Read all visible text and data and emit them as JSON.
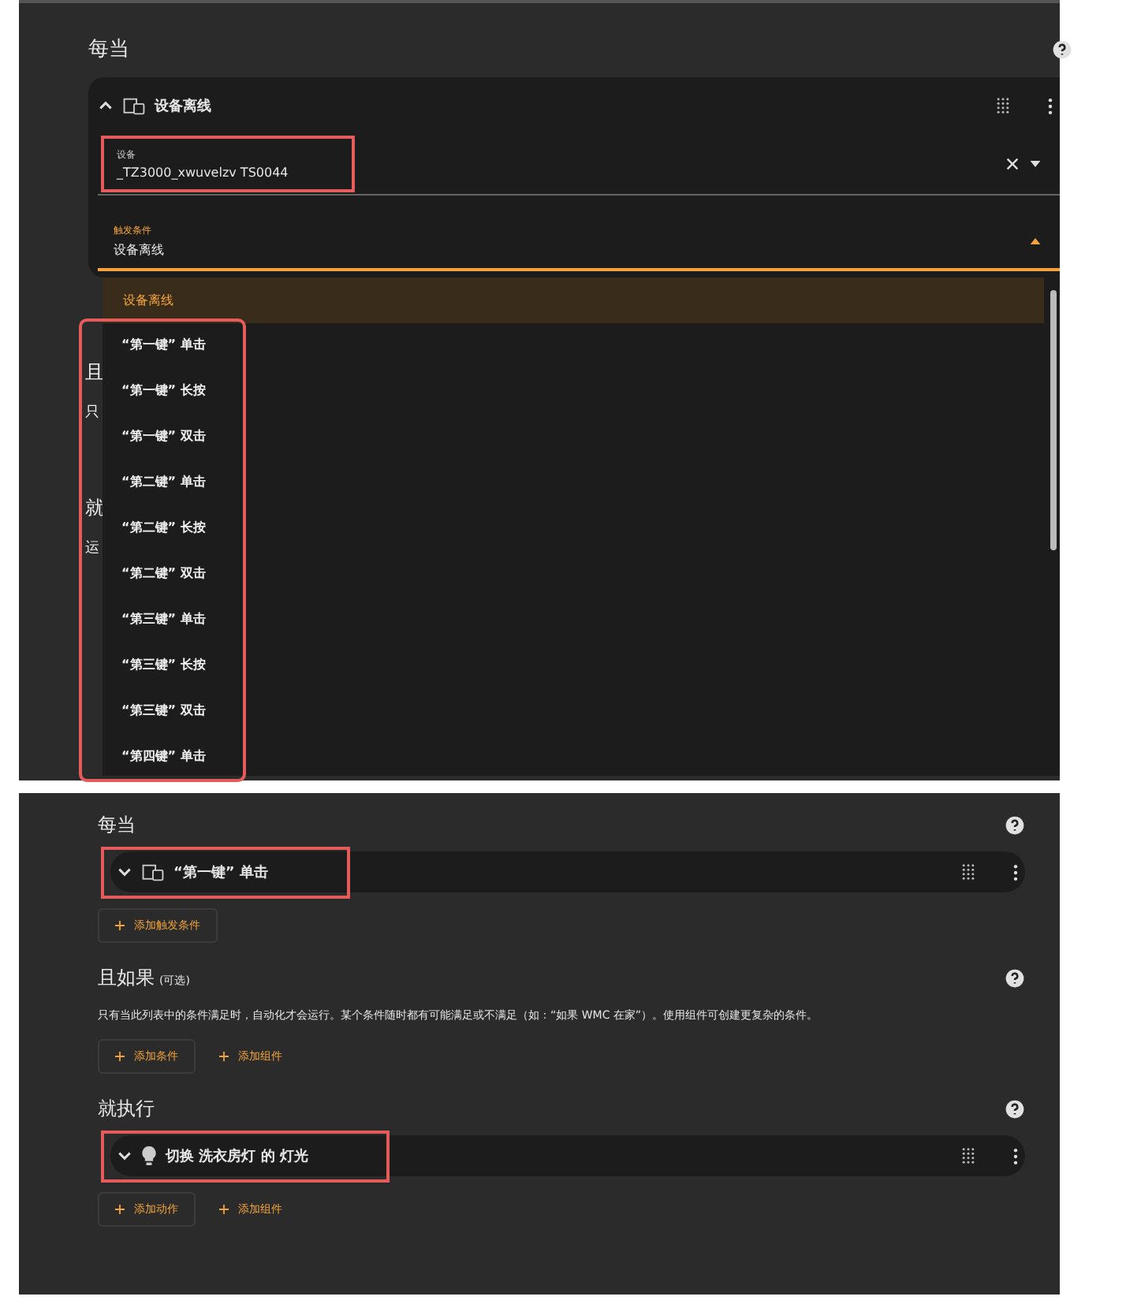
{
  "top_screenshot": {
    "section_title": "每当",
    "trigger_card": {
      "title": "设备离线",
      "expanded": true
    },
    "device_field": {
      "label": "设备",
      "value": "_TZ3000_xwuvelzv TS0044",
      "highlighted": true
    },
    "trigger_field": {
      "label": "触发条件",
      "value": "设备离线",
      "open": true
    },
    "dropdown_highlighted": true,
    "dropdown_options": [
      {
        "label": "设备离线",
        "selected": true
      },
      {
        "label": "“第一键” 单击",
        "selected": false
      },
      {
        "label": "“第一键” 长按",
        "selected": false
      },
      {
        "label": "“第一键” 双击",
        "selected": false
      },
      {
        "label": "“第二键” 单击",
        "selected": false
      },
      {
        "label": "“第二键” 长按",
        "selected": false
      },
      {
        "label": "“第二键” 双击",
        "selected": false
      },
      {
        "label": "“第三键” 单击",
        "selected": false
      },
      {
        "label": "“第三键” 长按",
        "selected": false
      },
      {
        "label": "“第三键” 双击",
        "selected": false
      },
      {
        "label": "“第四键” 单击",
        "selected": false
      }
    ],
    "covered_text": [
      "且",
      "只",
      "就",
      "运"
    ]
  },
  "bottom_screenshot": {
    "sections": [
      {
        "title": "每当",
        "items": [
          {
            "kind": "device",
            "title": "“第一键” 单击",
            "expanded": false,
            "highlighted": true
          }
        ],
        "buttons": [
          {
            "label": "添加触发条件",
            "framed": true
          }
        ]
      },
      {
        "title": "且如果",
        "note": "(可选)",
        "description": "只有当此列表中的条件满足时，自动化才会运行。某个条件随时都有可能满足或不满足（如：“如果 WMC 在家”）。使用组件可创建更复杂的条件。",
        "buttons": [
          {
            "label": "添加条件",
            "framed": true
          },
          {
            "label": "添加组件",
            "framed": false
          }
        ]
      },
      {
        "title": "就执行",
        "items": [
          {
            "kind": "light",
            "title": "切换 洗衣房灯 的 灯光",
            "expanded": false,
            "highlighted": true
          }
        ],
        "buttons": [
          {
            "label": "添加动作",
            "framed": true
          },
          {
            "label": "添加组件",
            "framed": false
          }
        ]
      }
    ]
  }
}
